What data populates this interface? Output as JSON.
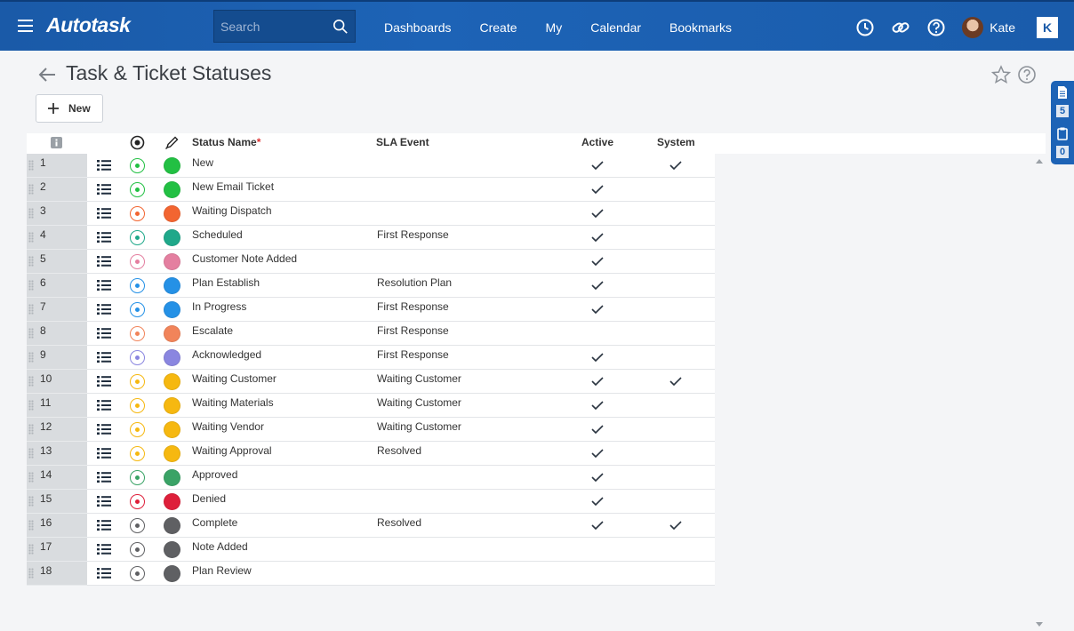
{
  "app": {
    "logo": "Autotask",
    "search_placeholder": "Search",
    "username": "Kate",
    "brand_letter": "K"
  },
  "nav": [
    "Dashboards",
    "Create",
    "My",
    "Calendar",
    "Bookmarks"
  ],
  "dock": {
    "notes_count": "5",
    "clipboard_count": "0"
  },
  "page": {
    "title": "Task & Ticket Statuses",
    "new_label": "New"
  },
  "columns": {
    "status_name": "Status Name",
    "required_mark": "*",
    "sla_event": "SLA Event",
    "active": "Active",
    "system": "System"
  },
  "rows": [
    {
      "num": "1",
      "name": "New",
      "sla": "",
      "active": true,
      "system": true,
      "color": "#22c043"
    },
    {
      "num": "2",
      "name": "New Email Ticket",
      "sla": "",
      "active": true,
      "system": false,
      "color": "#22c043"
    },
    {
      "num": "3",
      "name": "Waiting Dispatch",
      "sla": "",
      "active": true,
      "system": false,
      "color": "#f26531"
    },
    {
      "num": "4",
      "name": "Scheduled",
      "sla": "First Response",
      "active": true,
      "system": false,
      "color": "#1fa88a"
    },
    {
      "num": "5",
      "name": "Customer Note Added",
      "sla": "",
      "active": true,
      "system": false,
      "color": "#e47fa0"
    },
    {
      "num": "6",
      "name": "Plan Establish",
      "sla": "Resolution Plan",
      "active": true,
      "system": false,
      "color": "#2591e6"
    },
    {
      "num": "7",
      "name": "In Progress",
      "sla": "First Response",
      "active": true,
      "system": false,
      "color": "#2591e6"
    },
    {
      "num": "8",
      "name": "Escalate",
      "sla": "First Response",
      "active": false,
      "system": false,
      "color": "#f1845a"
    },
    {
      "num": "9",
      "name": "Acknowledged",
      "sla": "First Response",
      "active": true,
      "system": false,
      "color": "#8a86e0"
    },
    {
      "num": "10",
      "name": "Waiting Customer",
      "sla": "Waiting Customer",
      "active": true,
      "system": true,
      "color": "#f6b810"
    },
    {
      "num": "11",
      "name": "Waiting Materials",
      "sla": "Waiting Customer",
      "active": true,
      "system": false,
      "color": "#f6b810"
    },
    {
      "num": "12",
      "name": "Waiting Vendor",
      "sla": "Waiting Customer",
      "active": true,
      "system": false,
      "color": "#f6b810"
    },
    {
      "num": "13",
      "name": "Waiting Approval",
      "sla": "Resolved",
      "active": true,
      "system": false,
      "color": "#f6b810"
    },
    {
      "num": "14",
      "name": "Approved",
      "sla": "",
      "active": true,
      "system": false,
      "color": "#3aa366"
    },
    {
      "num": "15",
      "name": "Denied",
      "sla": "",
      "active": true,
      "system": false,
      "color": "#de1f3a"
    },
    {
      "num": "16",
      "name": "Complete",
      "sla": "Resolved",
      "active": true,
      "system": true,
      "color": "#5f6063"
    },
    {
      "num": "17",
      "name": "Note Added",
      "sla": "",
      "active": false,
      "system": false,
      "color": "#5f6063"
    },
    {
      "num": "18",
      "name": "Plan Review",
      "sla": "",
      "active": false,
      "system": false,
      "color": "#5f6063"
    }
  ]
}
